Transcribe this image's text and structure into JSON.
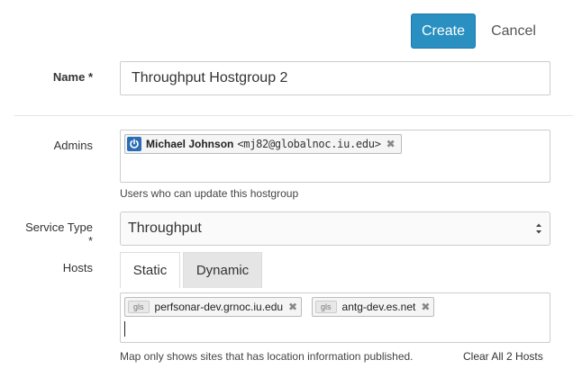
{
  "actions": {
    "create_label": "Create",
    "cancel_label": "Cancel"
  },
  "colors": {
    "accent": "#2a8fc1",
    "badge_blue": "#2a6db5"
  },
  "name_field": {
    "label": "Name *",
    "value": "Throughput Hostgroup 2"
  },
  "admins_field": {
    "label": "Admins",
    "tokens": [
      {
        "icon": "power-icon",
        "name": "Michael Johnson",
        "email": "<mj82@globalnoc.iu.edu>",
        "remove": "✖"
      }
    ],
    "help": "Users who can update this hostgroup"
  },
  "service_type": {
    "label_line1": "Service Type",
    "label_line2": "*",
    "value": "Throughput"
  },
  "hosts_field": {
    "label": "Hosts",
    "tabs": [
      {
        "label": "Static"
      },
      {
        "label": "Dynamic"
      }
    ],
    "tokens": [
      {
        "badge": "gls",
        "name": "perfsonar-dev.grnoc.iu.edu",
        "remove": "✖"
      },
      {
        "badge": "gls",
        "name": "antg-dev.es.net",
        "remove": "✖"
      }
    ],
    "help": "Map only shows sites that has location information published.",
    "clear_label": "Clear All 2 Hosts"
  }
}
